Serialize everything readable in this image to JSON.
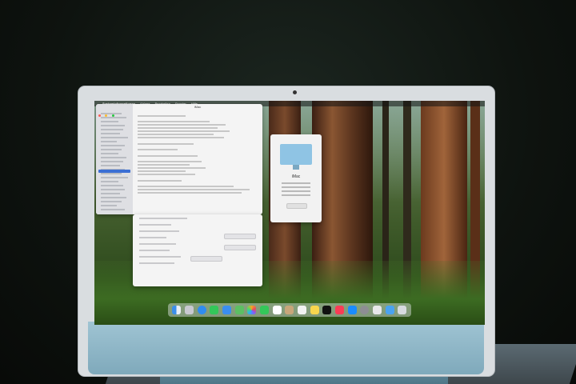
{
  "menubar": {
    "app": "Systeminformationen",
    "menus": [
      "Ablage",
      "Bearbeiten",
      "Fenster",
      "Hilfe"
    ]
  },
  "windows": {
    "system_info": {
      "title": "iMac"
    },
    "about": {
      "title": "iMac",
      "button_label": "Mehr Infos ..."
    }
  },
  "colors": {
    "imac_chin": "#8fb8ca",
    "selection": "#3b6fd4"
  },
  "dock_icons": [
    "finder-icon",
    "launchpad-icon",
    "safari-icon",
    "messages-icon",
    "mail-icon",
    "maps-icon",
    "photos-icon",
    "facetime-icon",
    "calendar-icon",
    "contacts-icon",
    "reminders-icon",
    "notes-icon",
    "tv-icon",
    "music-icon",
    "appstore-icon",
    "settings-icon",
    "preview-icon",
    "downloads-icon",
    "trash-icon"
  ]
}
